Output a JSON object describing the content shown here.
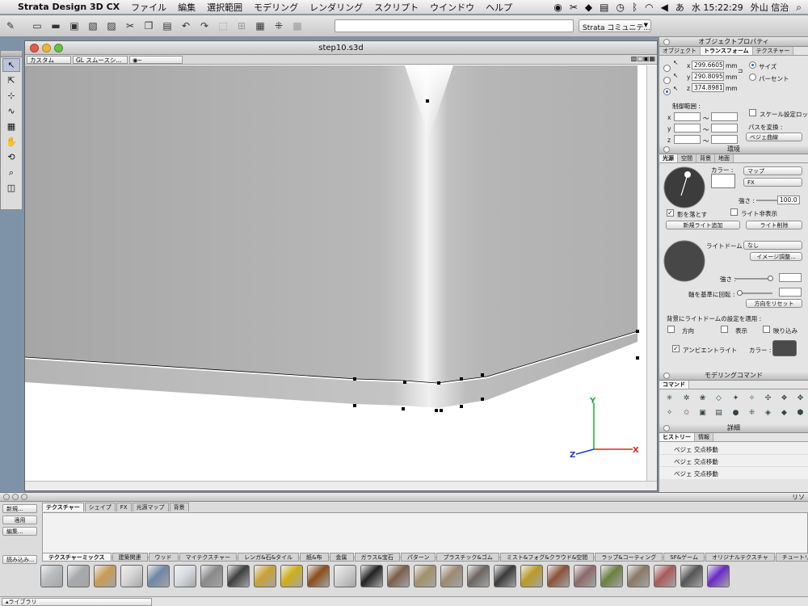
{
  "menubar": {
    "app_name": "Strata Design 3D CX",
    "items": [
      "ファイル",
      "編集",
      "選択範囲",
      "モデリング",
      "レンダリング",
      "スクリプト",
      "ウインドウ",
      "ヘルプ"
    ],
    "input_indicator": "あ",
    "clock": "水 15:22:29",
    "user": "外山 信治"
  },
  "toolbar": {
    "community_select": "Strata コミュニテ..."
  },
  "document": {
    "title": "step10.s3d",
    "view_mode": "カスタム",
    "render_mode": "GL スムースシ..."
  },
  "object_properties": {
    "panel_title": "オブジェクトプロパティ",
    "tabs": [
      "オブジェクト",
      "トランスフォーム",
      "テクスチャー"
    ],
    "active_tab": 1,
    "x": "299.6605",
    "y": "290.8095",
    "z": "374.8981",
    "unit": "mm",
    "size_label": "サイズ",
    "percent_label": "パーセント",
    "limits_label": "制御範囲 :",
    "tilde": "〜",
    "axis_x": "x",
    "axis_y": "y",
    "axis_z": "z",
    "scale_lock_label": "スケール設定ロック",
    "path_transform_label": "パスを変換 :",
    "path_transform_value": "ベジェ曲線"
  },
  "environment": {
    "panel_title": "環境",
    "tabs": [
      "光源",
      "空間",
      "背景",
      "地面"
    ],
    "active_tab": 0,
    "color_label": "カラー :",
    "map_select": "マップ",
    "fx_select": "FX",
    "strength_label": "強さ :",
    "strength_value": "100.0",
    "cast_shadow_label": "影を落とす",
    "hide_light_label": "ライト非表示",
    "new_light_button": "新規ライト追加",
    "delete_light_button": "ライト削除",
    "light_dome_label": "ライトドーム :",
    "light_dome_value": "なし",
    "image_adjust_button": "イメージ調整...",
    "strength2_label": "強さ :",
    "rotate_label": "軸を基準に回転 :",
    "reset_direction_button": "方向をリセット",
    "apply_dome_label": "背景にライトドームの設定を適用 :",
    "direction_label": "方向",
    "display_label": "表示",
    "reflection_label": "映り込み",
    "ambient_label": "アンビエントライト",
    "ambient_color_label": "カラー :",
    "ambient_color": "#4a4a4a"
  },
  "modeling_commands": {
    "panel_title": "モデリングコマンド",
    "tab": "コマンド"
  },
  "details": {
    "panel_title": "詳細",
    "tabs": [
      "ヒストリー",
      "情報"
    ],
    "active_tab": 0,
    "history": [
      "ベジェ 交点移動",
      "ベジェ 交点移動",
      "ベジェ 交点移動"
    ]
  },
  "library": {
    "title_right": "リソ",
    "buttons": [
      "新規...",
      "適用",
      "編集..."
    ],
    "load_button": "読み込み...",
    "library_select": "ライブラリ",
    "tabs": [
      "テクスチャー",
      "シェイプ",
      "FX",
      "光源マップ",
      "背景"
    ],
    "active_tab": 0,
    "categories": [
      "テクスチャーミックス",
      "建築関連",
      "ウッド",
      "マイテクスチャー",
      "レンガ&石&タイル",
      "紙&布",
      "金属",
      "ガラス&宝石",
      "パターン",
      "プラスチック&ゴム",
      "ミスト&フォグ&クラウド&空間",
      "ラップ&コーティング",
      "SF&ゲーム",
      "オリジナルテクスチャ",
      "チュートリアル"
    ],
    "active_category": 0,
    "swatches": [
      "#b9bcc0",
      "#a7aaad",
      "#c89b52",
      "#d7d7d7",
      "#6f86a6",
      "#d9dde2",
      "#898989",
      "#3f3f3f",
      "#c9a133",
      "#cfae1a",
      "#8a4e1c",
      "#d0d0d0",
      "#222222",
      "#7b5e4a",
      "#a2906a",
      "#9c8a72",
      "#6d6560",
      "#3a3a3a",
      "#b89b26",
      "#8a5238",
      "#8c6a6a",
      "#6b8040",
      "#8a7966",
      "#a85a58",
      "#555555",
      "#6a2ac8"
    ]
  },
  "axis_gizmo": {
    "x_label": "X",
    "y_label": "Y",
    "z_label": "Z"
  }
}
